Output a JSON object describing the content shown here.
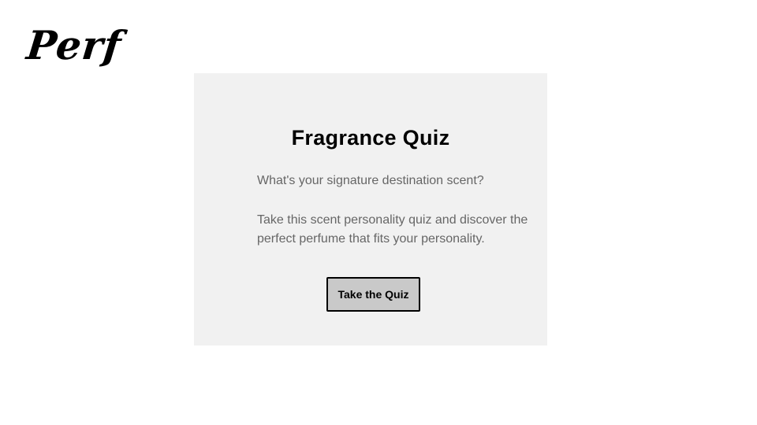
{
  "brand": {
    "logo_text": "Perf"
  },
  "quiz_card": {
    "title": "Fragrance Quiz",
    "tagline": "What's your signature destination scent?",
    "description": "Take this scent personality quiz and discover the perfect perfume that fits your personality.",
    "button_label": "Take the Quiz"
  },
  "colors": {
    "card_background": "#f1f1f1",
    "button_background": "#c9c9c9",
    "body_text": "#666666",
    "heading_text": "#000000"
  }
}
